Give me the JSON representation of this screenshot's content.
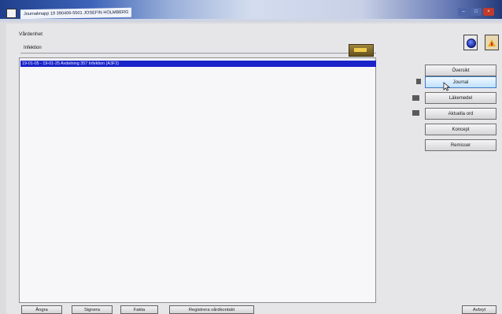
{
  "window": {
    "title": "Journalmapp 19 390406-5501 JOSEFIN HOLMBERG",
    "controls": [
      "–",
      "□",
      "×"
    ]
  },
  "vardenhet": {
    "label": "Vårdenhet",
    "value": "Infektion"
  },
  "contacts": [
    {
      "text": "19-01-05 - 19-01-25  Avdelning 357 Infektion (A3F3)",
      "selected": true
    }
  ],
  "nav": {
    "buttons": [
      "Översikt",
      "Journal",
      "Läkemedel",
      "Aktuella ord",
      "Koncept",
      "Remisser"
    ]
  },
  "footer": {
    "left_buttons": [
      "Ångra",
      "Signera",
      "Fakta",
      "Registrera vårdkontakt"
    ],
    "right_button": "Avbryt"
  },
  "icons": [
    "app-icon",
    "minimize-icon",
    "maximize-icon",
    "close-icon",
    "lookup-icon",
    "circle-icon",
    "warning-icon",
    "cursor-icon"
  ]
}
